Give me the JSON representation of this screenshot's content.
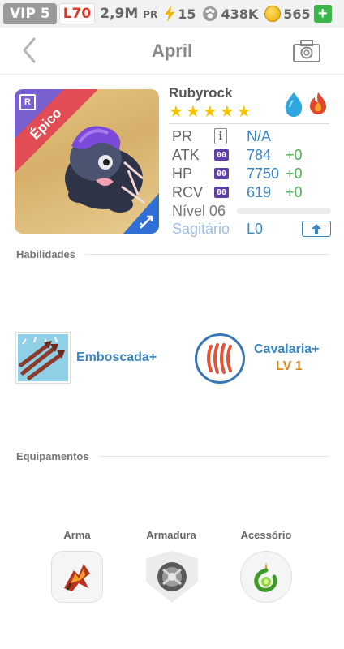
{
  "status_bar": {
    "vip": "VIP 5",
    "level": "L70",
    "power": "2,9M",
    "power_unit": "PR",
    "energy": "15",
    "paws": "438K",
    "gold": "565",
    "add": "+"
  },
  "header": {
    "title": "April"
  },
  "hero": {
    "name": "Rubyrock",
    "rarity_label": "Épico",
    "rarity_badge": "R",
    "stars": 5,
    "stats": [
      {
        "label": "PR",
        "value": "N/A",
        "bonus": ""
      },
      {
        "label": "ATK",
        "value": "784",
        "bonus": "+0",
        "badge": "00"
      },
      {
        "label": "HP",
        "value": "7750",
        "bonus": "+0",
        "badge": "00"
      },
      {
        "label": "RCV",
        "value": "619",
        "bonus": "+0",
        "badge": "00"
      }
    ],
    "level_label": "Nível 06",
    "zodiac": "Sagitário",
    "zodiac_level": "L0",
    "info_icon": "i"
  },
  "sections": {
    "skills": "Habilidades",
    "equipment": "Equipamentos"
  },
  "skills": [
    {
      "name": "Emboscada+"
    },
    {
      "name": "Cavalaria+",
      "level": "LV 1"
    }
  ],
  "equipment": [
    {
      "label": "Arma"
    },
    {
      "label": "Armadura"
    },
    {
      "label": "Acessório"
    }
  ],
  "colors": {
    "accent_blue": "#3b86c4",
    "bonus_green": "#47b34f",
    "rarity_red": "#e24c54",
    "star_gold": "#f5c400",
    "skill_level_orange": "#e2841f"
  }
}
